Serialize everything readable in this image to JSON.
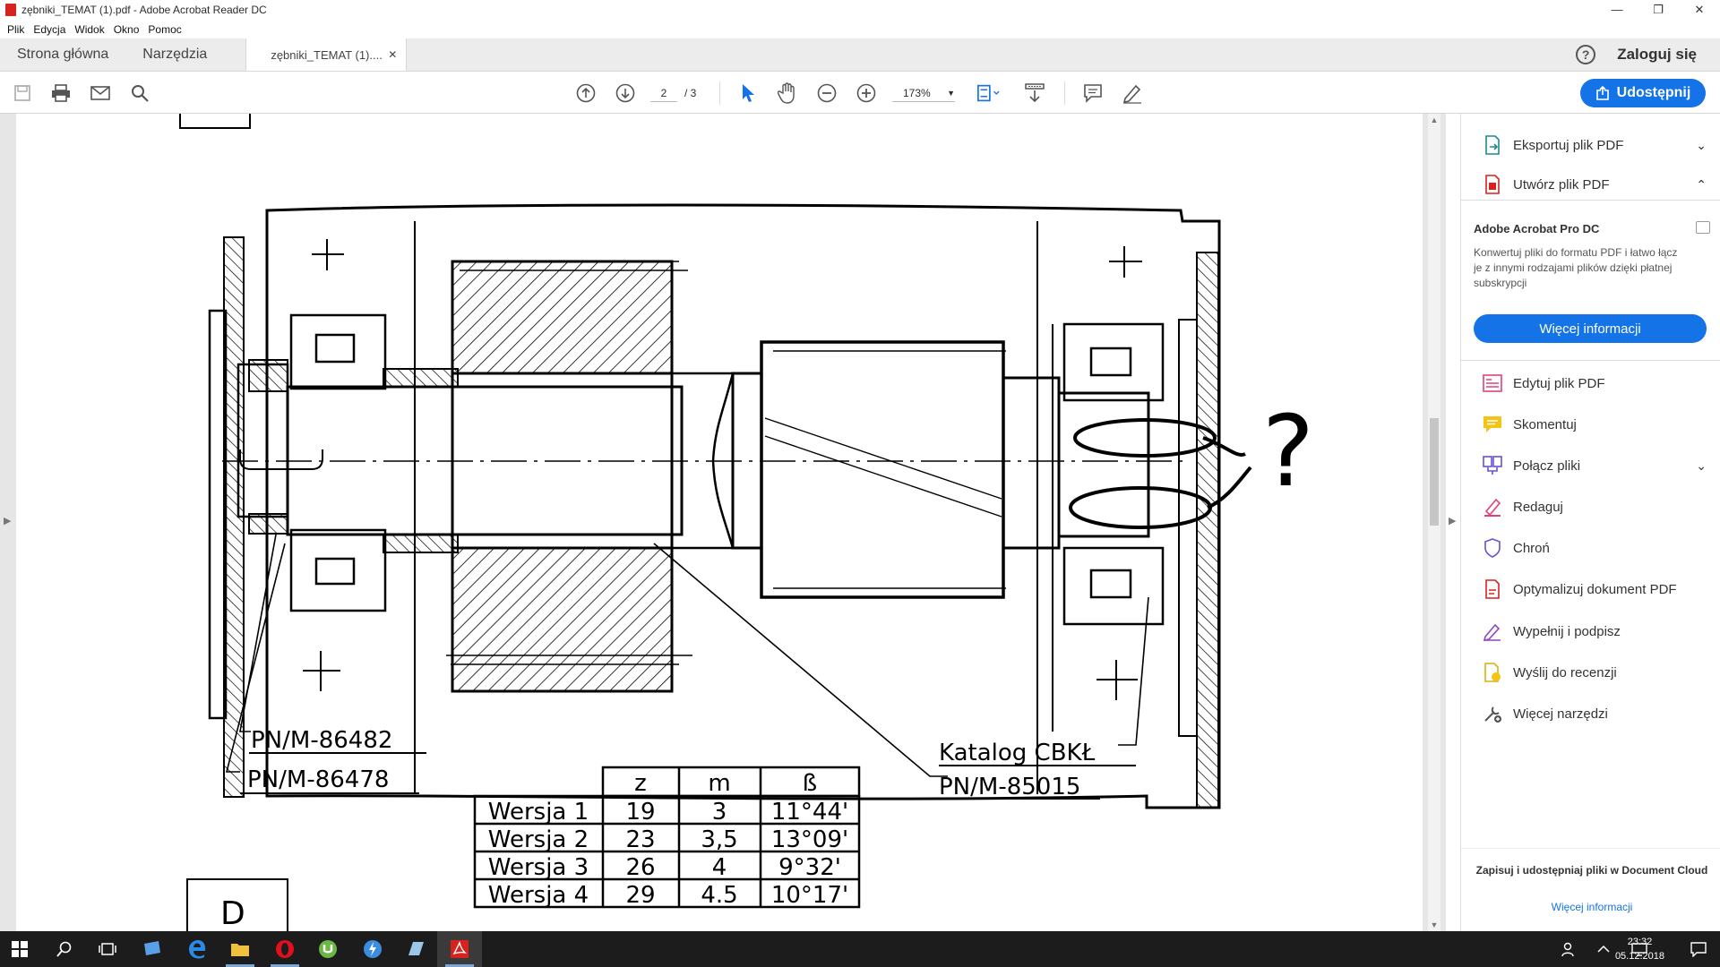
{
  "window": {
    "title": "zębniki_TEMAT (1).pdf - Adobe Acrobat Reader DC",
    "minimize": "—",
    "maximize": "❐",
    "close": "✕"
  },
  "menu": [
    "Plik",
    "Edycja",
    "Widok",
    "Okno",
    "Pomoc"
  ],
  "tabs": {
    "home": "Strona główna",
    "tools": "Narzędzia",
    "document": "zębniki_TEMAT (1)....",
    "document_close": "✕",
    "login": "Zaloguj się",
    "help": "?"
  },
  "toolbar": {
    "page_current": "2",
    "page_total": "/ 3",
    "zoom": "173%",
    "share": "Udostępnij"
  },
  "right_panel": {
    "export": "Eksportuj plik PDF",
    "create": "Utwórz plik PDF",
    "promo_title": "Adobe Acrobat Pro DC",
    "promo_text": "Konwertuj pliki do formatu PDF i łatwo łącz je z innymi rodzajami plików dzięki płatnej subskrypcji",
    "promo_button": "Więcej informacji",
    "tools": [
      "Edytuj plik PDF",
      "Skomentuj",
      "Połącz pliki",
      "Redaguj",
      "Chroń",
      "Optymalizuj dokument PDF",
      "Wypełnij i podpisz",
      "Wyślij do recenzji",
      "Więcej narzędzi"
    ],
    "footer": "Zapisuj i udostępniaj pliki w Document Cloud",
    "footer_link": "Więcej informacji"
  },
  "drawing": {
    "label_pn1": "PN/M-86482",
    "label_pn2": "PN/M-86478",
    "label_catalog": "Katalog CBKŁ",
    "label_pn3": "PN/M-85015",
    "letter_d": "D",
    "question": "?",
    "table_headers": [
      "",
      "z",
      "m",
      "ß"
    ],
    "table_rows": [
      [
        "Wersja 1",
        "19",
        "3",
        "11°44'"
      ],
      [
        "Wersja 2",
        "23",
        "3,5",
        "13°09'"
      ],
      [
        "Wersja 3",
        "26",
        "4",
        "9°32'"
      ],
      [
        "Wersja 4",
        "29",
        "4.5",
        "10°17'"
      ]
    ]
  },
  "taskbar": {
    "time": "23:32",
    "date": "05.12.2018"
  },
  "colors": {
    "accent": "#1473e6",
    "acrobat_red": "#d7221d",
    "taskbar": "#1c1c1c"
  }
}
